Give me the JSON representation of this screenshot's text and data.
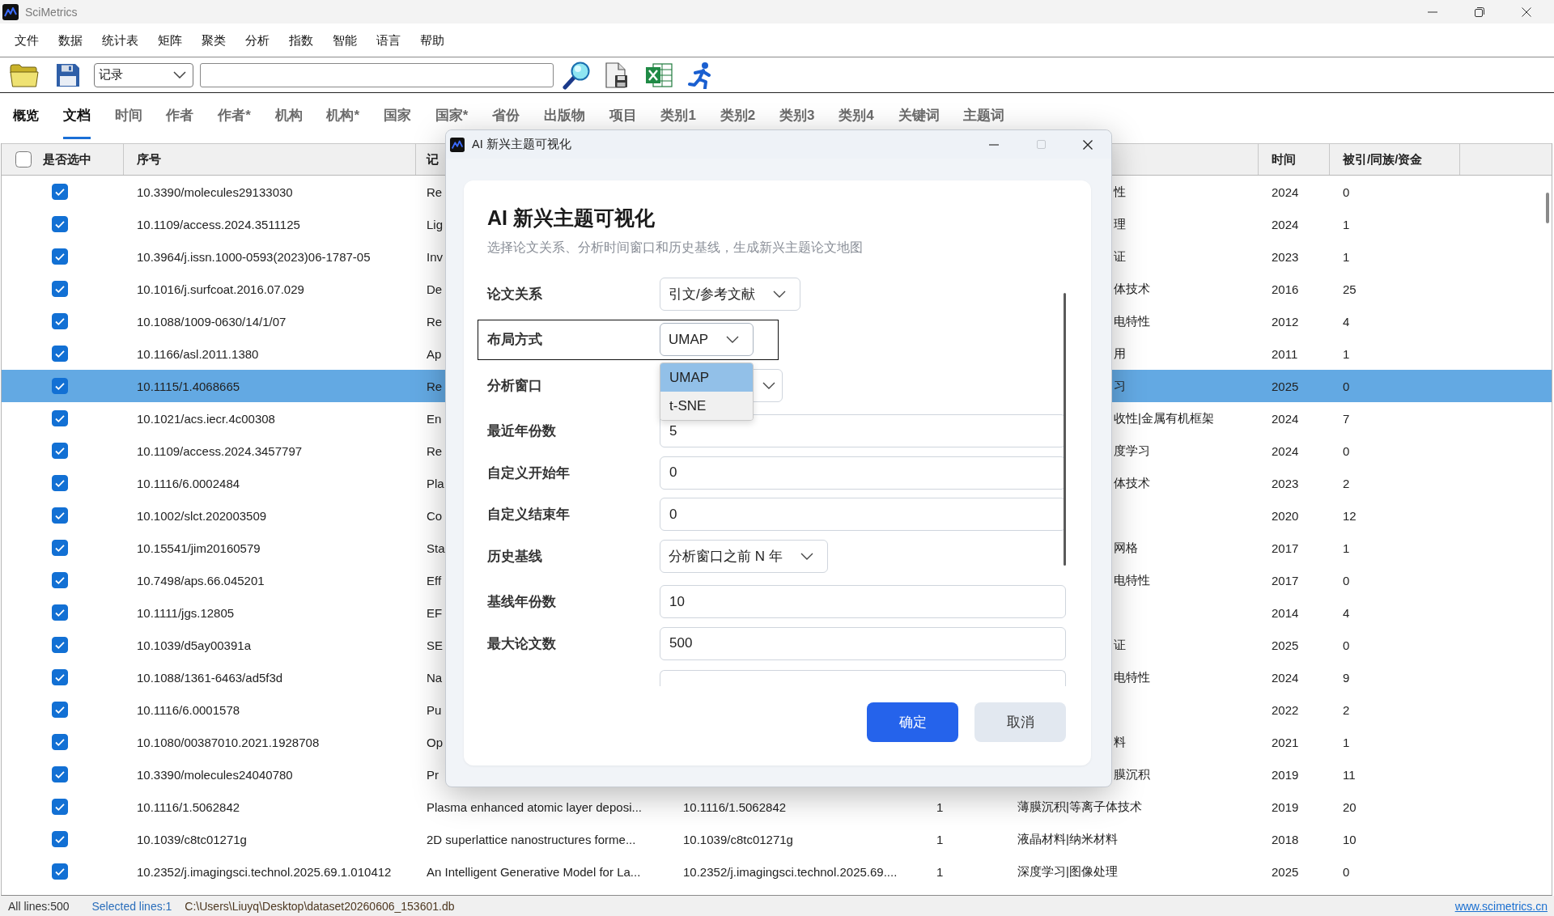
{
  "app": {
    "title": "SciMetrics"
  },
  "menu": [
    "文件",
    "数据",
    "统计表",
    "矩阵",
    "聚类",
    "分析",
    "指数",
    "智能",
    "语言",
    "帮助"
  ],
  "toolbar": {
    "record_type": "记录"
  },
  "tabs": [
    {
      "label": "概览",
      "kind": "overview",
      "selected": false
    },
    {
      "label": "文档",
      "kind": "tab",
      "selected": true
    },
    {
      "label": "时间",
      "kind": "tab",
      "selected": false
    },
    {
      "label": "作者",
      "kind": "tab",
      "selected": false
    },
    {
      "label": "作者*",
      "kind": "tab",
      "selected": false
    },
    {
      "label": "机构",
      "kind": "tab",
      "selected": false
    },
    {
      "label": "机构*",
      "kind": "tab",
      "selected": false
    },
    {
      "label": "国家",
      "kind": "tab",
      "selected": false
    },
    {
      "label": "国家*",
      "kind": "tab",
      "selected": false
    },
    {
      "label": "省份",
      "kind": "tab",
      "selected": false
    },
    {
      "label": "出版物",
      "kind": "tab",
      "selected": false
    },
    {
      "label": "项目",
      "kind": "tab",
      "selected": false
    },
    {
      "label": "类别1",
      "kind": "tab",
      "selected": false
    },
    {
      "label": "类别2",
      "kind": "tab",
      "selected": false
    },
    {
      "label": "类别3",
      "kind": "tab",
      "selected": false
    },
    {
      "label": "类别4",
      "kind": "tab",
      "selected": false
    },
    {
      "label": "关键词",
      "kind": "tab",
      "selected": false
    },
    {
      "label": "主题词",
      "kind": "tab",
      "selected": false
    }
  ],
  "table": {
    "header": {
      "checked": false,
      "checked_label": "是否选中",
      "serial": "序号",
      "column_3": "记",
      "time": "时间",
      "citations": "被引/同族/资金"
    },
    "rows": [
      {
        "checked": true,
        "selected": false,
        "serial": "10.3390/molecules29133030",
        "column_3": "Re",
        "column_6": "性",
        "time": "2024",
        "citations": "0"
      },
      {
        "checked": true,
        "selected": false,
        "serial": "10.1109/access.2024.3511125",
        "column_3": "Lig",
        "column_6": "理",
        "time": "2024",
        "citations": "1"
      },
      {
        "checked": true,
        "selected": false,
        "serial": "10.3964/j.issn.1000-0593(2023)06-1787-05",
        "column_3": "Inv",
        "column_6": "证",
        "time": "2023",
        "citations": "1"
      },
      {
        "checked": true,
        "selected": false,
        "serial": "10.1016/j.surfcoat.2016.07.029",
        "column_3": "De",
        "column_6": "体技术",
        "time": "2016",
        "citations": "25"
      },
      {
        "checked": true,
        "selected": false,
        "serial": "10.1088/1009-0630/14/1/07",
        "column_3": "Re",
        "column_6": "电特性",
        "time": "2012",
        "citations": "4"
      },
      {
        "checked": true,
        "selected": false,
        "serial": "10.1166/asl.2011.1380",
        "column_3": "Ap",
        "column_6": "用",
        "time": "2011",
        "citations": "1"
      },
      {
        "checked": true,
        "selected": true,
        "serial": "10.1115/1.4068665",
        "column_3": "Re",
        "column_6": "习",
        "time": "2025",
        "citations": "0"
      },
      {
        "checked": true,
        "selected": false,
        "serial": "10.1021/acs.iecr.4c00308",
        "column_3": "En",
        "column_6": "收性|金属有机框架",
        "time": "2024",
        "citations": "7"
      },
      {
        "checked": true,
        "selected": false,
        "serial": "10.1109/access.2024.3457797",
        "column_3": "Re",
        "column_6": "度学习",
        "time": "2024",
        "citations": "0"
      },
      {
        "checked": true,
        "selected": false,
        "serial": "10.1116/6.0002484",
        "column_3": "Pla",
        "column_6": "体技术",
        "time": "2023",
        "citations": "2"
      },
      {
        "checked": true,
        "selected": false,
        "serial": "10.1002/slct.202003509",
        "column_3": "Co",
        "time": "2020",
        "citations": "12"
      },
      {
        "checked": true,
        "selected": false,
        "serial": "10.15541/jim20160579",
        "column_3": "Sta",
        "column_6": "网格",
        "time": "2017",
        "citations": "1"
      },
      {
        "checked": true,
        "selected": false,
        "serial": "10.7498/aps.66.045201",
        "column_3": "Eff",
        "column_6": "电特性",
        "time": "2017",
        "citations": "0"
      },
      {
        "checked": true,
        "selected": false,
        "serial": "10.1111/jgs.12805",
        "column_3": "EF",
        "time": "2014",
        "citations": "4"
      },
      {
        "checked": true,
        "selected": false,
        "serial": "10.1039/d5ay00391a",
        "column_3": "SE",
        "column_6": "证",
        "time": "2025",
        "citations": "0"
      },
      {
        "checked": true,
        "selected": false,
        "serial": "10.1088/1361-6463/ad5f3d",
        "column_3": "Na",
        "column_6": "电特性",
        "time": "2024",
        "citations": "9"
      },
      {
        "checked": true,
        "selected": false,
        "serial": "10.1116/6.0001578",
        "column_3": "Pu",
        "time": "2022",
        "citations": "2"
      },
      {
        "checked": true,
        "selected": false,
        "serial": "10.1080/00387010.2021.1928708",
        "column_3": "Op",
        "column_6": "料",
        "time": "2021",
        "citations": "1"
      },
      {
        "checked": true,
        "selected": false,
        "serial": "10.3390/molecules24040780",
        "column_3": "Pr",
        "column_6": "膜沉积",
        "time": "2019",
        "citations": "11"
      },
      {
        "checked": true,
        "selected": false,
        "serial": "10.1116/1.5062842",
        "column_3": "Plasma enhanced atomic layer deposi...",
        "column_4": "10.1116/1.5062842",
        "column_5": "1",
        "column_6": "薄膜沉积|等离子体技术",
        "time": "2019",
        "citations": "20"
      },
      {
        "checked": true,
        "selected": false,
        "serial": "10.1039/c8tc01271g",
        "column_3": "2D superlattice nanostructures forme...",
        "column_4": "10.1039/c8tc01271g",
        "column_5": "1",
        "column_6": "液晶材料|纳米材料",
        "time": "2018",
        "citations": "10"
      },
      {
        "checked": true,
        "selected": false,
        "serial": "10.2352/j.imagingsci.technol.2025.69.1.010412",
        "column_3": "An Intelligent Generative Model for La...",
        "column_4": "10.2352/j.imagingsci.technol.2025.69....",
        "column_5": "1",
        "column_6": "深度学习|图像处理",
        "time": "2025",
        "citations": "0"
      }
    ]
  },
  "dialog": {
    "title": "AI 新兴主题可视化",
    "maximize_disabled": true,
    "heading": "AI 新兴主题可视化",
    "subtitle": "选择论文关系、分析时间窗口和历史基线，生成新兴主题论文地图",
    "fields": [
      {
        "label": "论文关系",
        "kind": "select",
        "value": "引文/参考文献",
        "focused": false,
        "expanded": false
      },
      {
        "label": "布局方式",
        "kind": "select",
        "value": "UMAP",
        "focused": true,
        "expanded": true,
        "options": [
          {
            "label": "UMAP",
            "selected": true
          },
          {
            "label": "t-SNE",
            "selected": false
          }
        ]
      },
      {
        "label": "分析窗口",
        "kind": "select",
        "focused": false,
        "expanded": false
      },
      {
        "label": "最近年份数",
        "kind": "input",
        "value": "5",
        "focused": false
      },
      {
        "label": "自定义开始年",
        "kind": "input",
        "value": "0",
        "focused": false
      },
      {
        "label": "自定义结束年",
        "kind": "input",
        "value": "0",
        "focused": false
      },
      {
        "label": "历史基线",
        "kind": "select",
        "value": "分析窗口之前 N 年",
        "focused": false,
        "expanded": false
      },
      {
        "label": "基线年份数",
        "kind": "input",
        "value": "10",
        "focused": false
      },
      {
        "label": "最大论文数",
        "kind": "input",
        "value": "500",
        "focused": false
      },
      {
        "kind": "partial",
        "focused": false
      }
    ],
    "buttons": [
      {
        "label": "确定",
        "kind": "primary"
      },
      {
        "label": "取消",
        "kind": "secondary"
      }
    ]
  },
  "status_bar": {
    "line_count": "All lines:500",
    "selected_count": "Selected lines:1",
    "file_path": "C:\\Users\\Liuyq\\Desktop\\dataset20260606_153601.db",
    "website": "www.scimetrics.cn"
  }
}
